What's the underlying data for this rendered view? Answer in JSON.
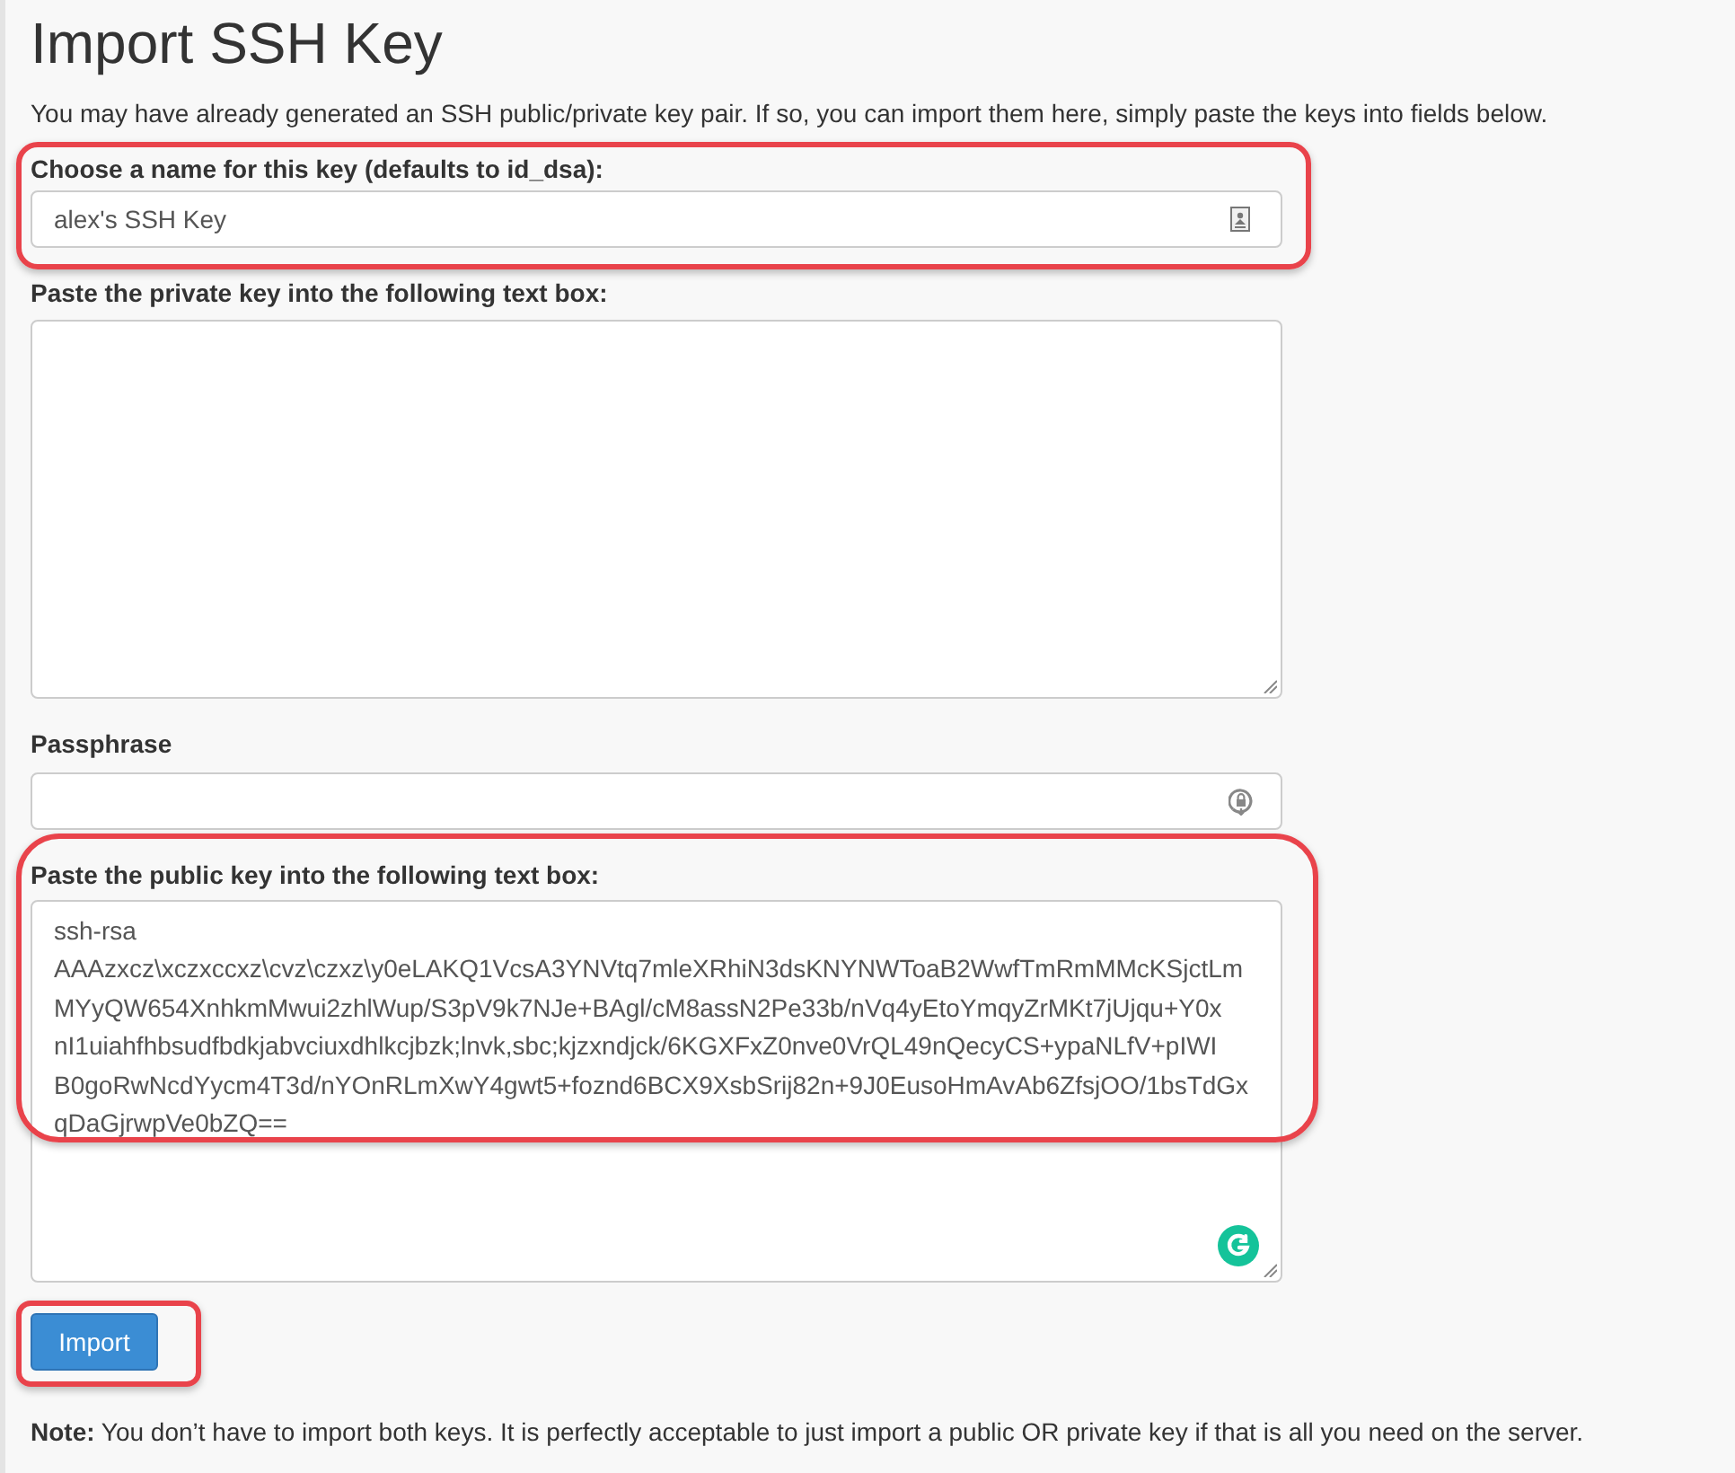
{
  "page": {
    "title": "Import SSH Key",
    "intro": "You may have already generated an SSH public/private key pair. If so, you can import them here, simply paste the keys into fields below."
  },
  "form": {
    "name_field": {
      "label": "Choose a name for this key (defaults to id_dsa):",
      "value": "alex's SSH Key",
      "highlighted": true
    },
    "private_key": {
      "label": "Paste the private key into the following text box:"
    },
    "passphrase": {
      "label": "Passphrase"
    },
    "public_key": {
      "label": "Paste the public key into the following text box:",
      "value_lines": [
        "ssh-rsa",
        "AAAzxcz\\xczxccxz\\cvz\\czxz\\y0eLAKQ1VcsA3YNVtq7mleXRhiN3dsKNYNWToaB2WwfTmRmMMcKSjctLm",
        "MYyQW654XnhkmMwui2zhlWup/S3pV9k7NJe+BAgl/cM8assN2Pe33b/nVq4yEtoYmqyZrMKt7jUjqu+Y0x",
        "nI1uiahfhbsudfbdkjabvciuxdhlkcjbzk;lnvk,sbc;kjzxndjck/6KGXFxZ0nve0VrQL49nQecyCS+ypaNLfV+pIWI",
        "B0goRwNcdYycm4T3d/nYOnRLmXwY4gwt5+foznd6BCX9XsbSrij82n+9J0EusoHmAvAb6ZfsjOO/1bsTdGx",
        "qDaGjrwpVe0bZQ=="
      ],
      "highlighted": true
    },
    "import_button": {
      "label": "Import",
      "highlighted": true
    }
  },
  "note": "**Note:** You don’t have to import both keys. It is perfectly acceptable to just import a public OR private key if that is all you need on the server."
}
